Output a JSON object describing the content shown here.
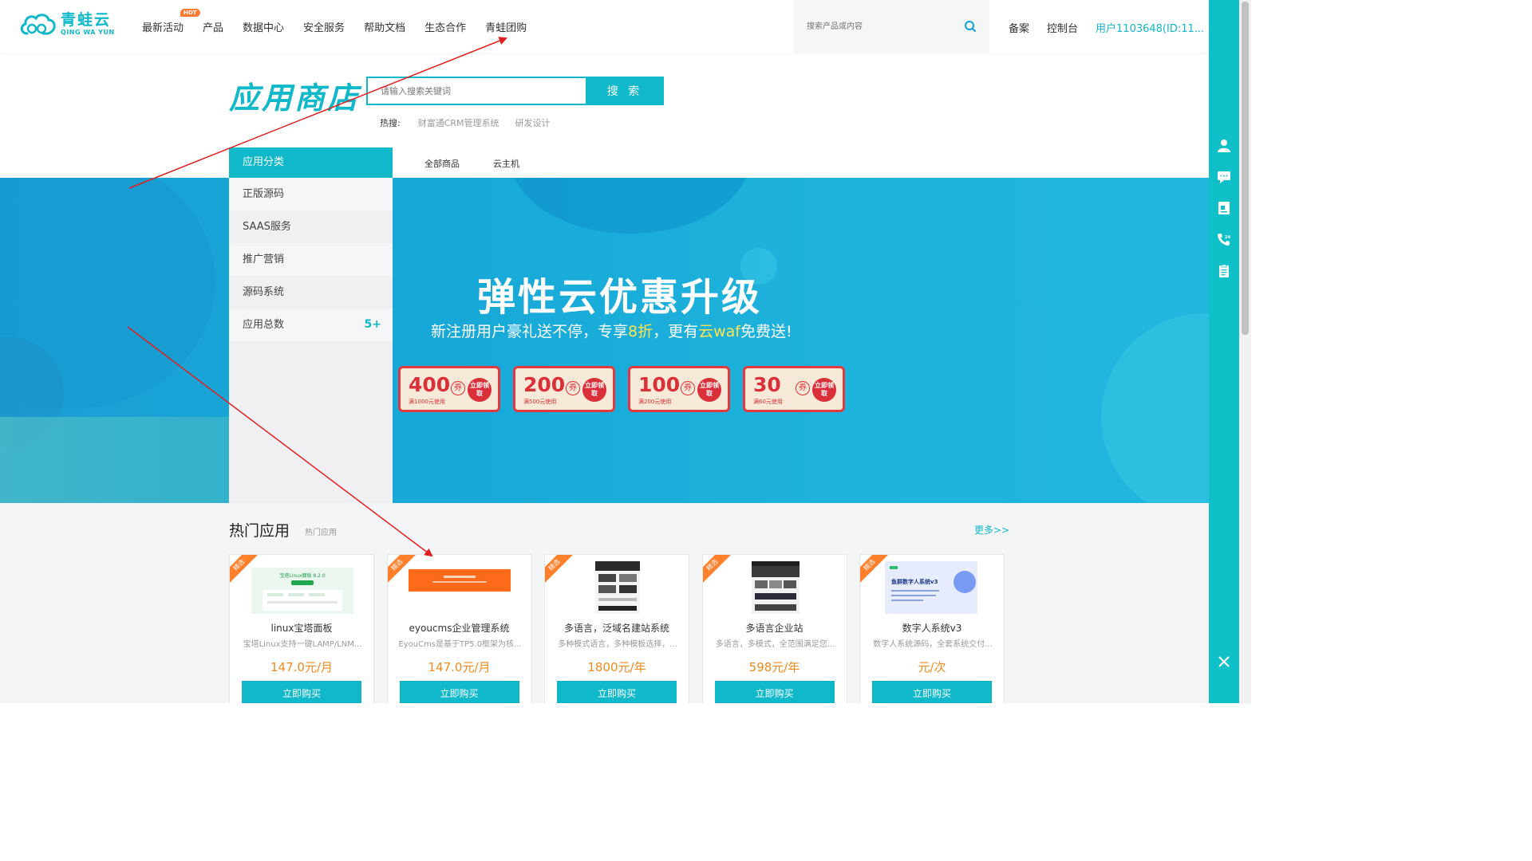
{
  "logo": {
    "cn": "青蛙云",
    "en": "QING WA YUN"
  },
  "nav": {
    "items": [
      "最新活动",
      "产品",
      "数据中心",
      "安全服务",
      "帮助文档",
      "生态合作",
      "青蛙团购"
    ],
    "hot_badge": "HOT"
  },
  "top_search": {
    "placeholder": "搜索产品或内容"
  },
  "top_right": {
    "beian": "备案",
    "console": "控制台",
    "user": "用户1103648(ID:11..."
  },
  "store": {
    "title": "应用商店",
    "search_placeholder": "请输入搜索关键词",
    "search_button": "搜 索",
    "hot_label": "热搜:",
    "hot_keywords": [
      "财富通CRM管理系统",
      "研发设计"
    ]
  },
  "categories": {
    "header": "应用分类",
    "items": [
      "正版源码",
      "SAAS服务",
      "推广营销",
      "源码系统",
      "应用总数"
    ],
    "count_badge": "5+"
  },
  "tabs": [
    "全部商品",
    "云主机"
  ],
  "banner": {
    "title": "弹性云优惠升级",
    "sub_part1": "新注册用户豪礼送不停，专享",
    "sub_hl1": "8折",
    "sub_part2": "，更有",
    "sub_hl2": "云waf",
    "sub_part3": "免费送!",
    "coupons": [
      {
        "amount": "400",
        "cond": "满1000元使用"
      },
      {
        "amount": "200",
        "cond": "满500元使用"
      },
      {
        "amount": "100",
        "cond": "满200元使用"
      },
      {
        "amount": "30",
        "cond": "满60元使用"
      }
    ],
    "coupon_unit": "券",
    "coupon_action": "立即领取"
  },
  "hot_apps": {
    "title": "热门应用",
    "subtitle": "热门应用",
    "more": "更多>>",
    "ribbon": "精选",
    "buy_label": "立即购买",
    "cards": [
      {
        "name": "linux宝塔面板",
        "desc": "宝塔Linux支持一键LAMP/LNM...",
        "price": "147.0元/月"
      },
      {
        "name": "eyoucms企业管理系统",
        "desc": "EyouCms是基于TP5.0框架为核...",
        "price": "147.0元/月"
      },
      {
        "name": "多语言，泛域名建站系统",
        "desc": "多种模式语言，多种模板选择，...",
        "price": "1800元/年"
      },
      {
        "name": "多语言企业站",
        "desc": "多语言，多模式，全范围满足您...",
        "price": "598元/年"
      },
      {
        "name": "数字人系统v3",
        "desc": "数字人系统源码，全套系统交付...",
        "price": "元/次"
      }
    ],
    "thumb_texts": [
      "宝塔Linux面板 8.2.0",
      "鱼群数字人系统v3"
    ]
  },
  "colors": {
    "accent": "#10b8c9",
    "price": "#f08a1c",
    "coupon_red": "#d9303a",
    "annotation_arrow": "#e02020"
  }
}
